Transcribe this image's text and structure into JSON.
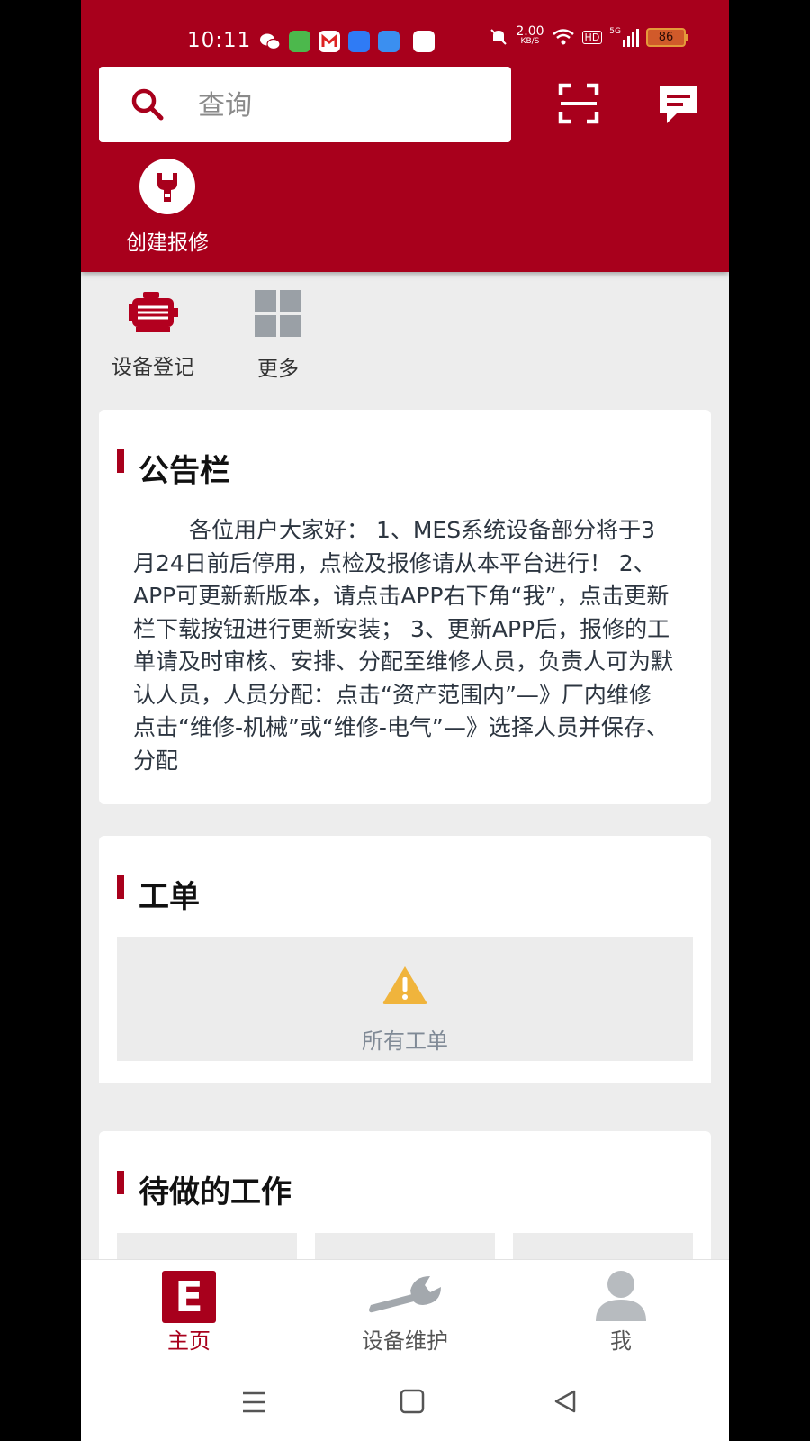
{
  "status_bar": {
    "time": "10:11",
    "net_speed_value": "2.00",
    "net_speed_unit": "KB/S",
    "hd_label": "HD",
    "signal_label": "5G",
    "battery": "86"
  },
  "search": {
    "placeholder": "查询"
  },
  "header": {
    "create_repair_label": "创建报修"
  },
  "quick_items": [
    {
      "label": "设备登记",
      "icon": "machine-icon"
    },
    {
      "label": "更多",
      "icon": "grid-icon"
    }
  ],
  "notice": {
    "title": "公告栏",
    "text": "各位用户大家好： 1、MES系统设备部分将于3月24日前后停用，点检及报修请从本平台进行！ 2、APP可更新新版本，请点击APP右下角“我”，点击更新栏下载按钮进行更新安装； 3、更新APP后，报修的工单请及时审核、安排、分配至维修人员，负责人可为默认人员，人员分配：点击“资产范围内”—》厂内维修点击“维修-机械”或“维修-电气”—》选择人员并保存、分配"
  },
  "workorder": {
    "title": "工单",
    "all_label": "所有工单"
  },
  "todo": {
    "title": "待做的工作"
  },
  "tabs": [
    {
      "label": "主页",
      "active": true
    },
    {
      "label": "设备维护",
      "active": false
    },
    {
      "label": "我",
      "active": false
    }
  ],
  "home_logo_letter": "E",
  "colors": {
    "brand": "#a8001c",
    "background": "#ededed",
    "warning": "#f0b43c",
    "inactive": "#9aa0a6"
  }
}
